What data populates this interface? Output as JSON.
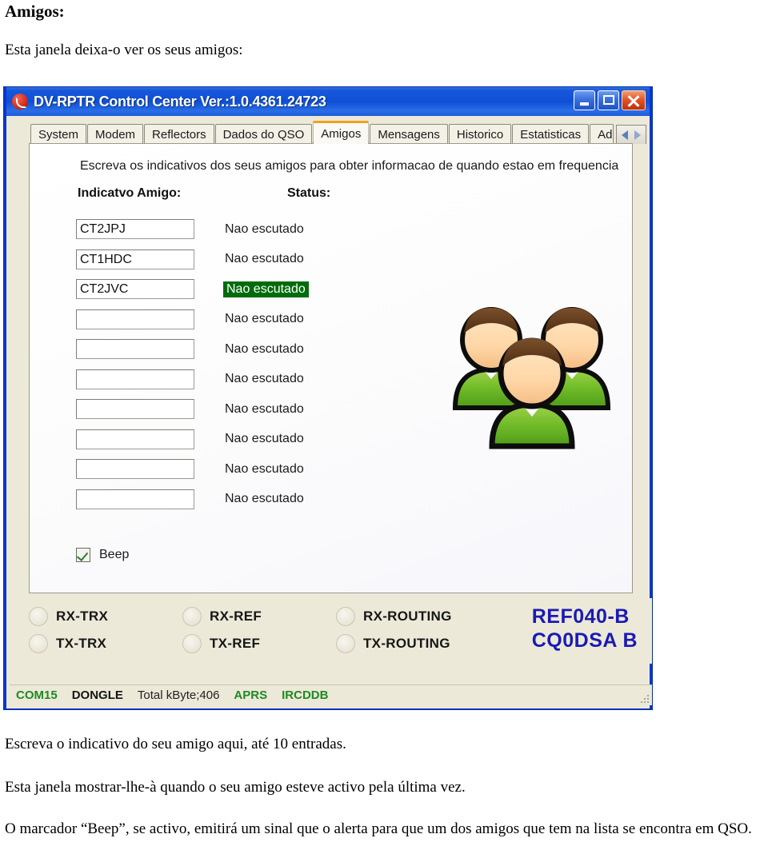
{
  "document": {
    "heading": "Amigos:",
    "intro": "Esta janela deixa-o ver os seus amigos:",
    "para1": "Escreva o indicativo do seu amigo aqui, até 10 entradas.",
    "para2": "Esta janela mostrar-lhe-à quando o seu amigo esteve activo pela última vez.",
    "para3": "O marcador “Beep”, se activo, emitirá um sinal que o alerta para que um dos amigos que tem na lista se encontra em QSO."
  },
  "window": {
    "title": "DV-RPTR Control Center Ver.:1.0.4361.24723",
    "icon": "antenna-icon",
    "controls": {
      "minimize": "minimize-icon",
      "maximize": "maximize-icon",
      "close": "close-icon"
    }
  },
  "tabs": [
    {
      "label": "System",
      "active": false
    },
    {
      "label": "Modem",
      "active": false
    },
    {
      "label": "Reflectors",
      "active": false
    },
    {
      "label": "Dados do QSO",
      "active": false
    },
    {
      "label": "Amigos",
      "active": true
    },
    {
      "label": "Mensagens",
      "active": false
    },
    {
      "label": "Historico",
      "active": false
    },
    {
      "label": "Estatisticas",
      "active": false
    },
    {
      "label": "Adr",
      "active": false
    }
  ],
  "tab_scroll": {
    "left": "◄",
    "right": "►"
  },
  "page": {
    "hint": "Escreva os indicativos dos seus amigos para obter informacao de quando estao em frequencia",
    "col_callsign": "Indicatvo Amigo:",
    "col_status": "Status:",
    "placeholder": "",
    "rows": [
      {
        "callsign": "CT2JPJ",
        "status": "Nao escutado",
        "highlight": false
      },
      {
        "callsign": "CT1HDC",
        "status": "Nao escutado",
        "highlight": false
      },
      {
        "callsign": "CT2JVC",
        "status": "Nao escutado",
        "highlight": true
      },
      {
        "callsign": "",
        "status": "Nao escutado",
        "highlight": false
      },
      {
        "callsign": "",
        "status": "Nao escutado",
        "highlight": false
      },
      {
        "callsign": "",
        "status": "Nao escutado",
        "highlight": false
      },
      {
        "callsign": "",
        "status": "Nao escutado",
        "highlight": false
      },
      {
        "callsign": "",
        "status": "Nao escutado",
        "highlight": false
      },
      {
        "callsign": "",
        "status": "Nao escutado",
        "highlight": false
      },
      {
        "callsign": "",
        "status": "Nao escutado",
        "highlight": false
      }
    ],
    "beep": {
      "label": "Beep",
      "checked": true
    }
  },
  "footer": {
    "leds": [
      {
        "label": "RX-TRX",
        "on": false
      },
      {
        "label": "RX-REF",
        "on": false
      },
      {
        "label": "RX-ROUTING",
        "on": false
      },
      {
        "label": "TX-TRX",
        "on": false
      },
      {
        "label": "TX-REF",
        "on": false
      },
      {
        "label": "TX-ROUTING",
        "on": false
      }
    ],
    "reflector_line1": "REF040-B",
    "reflector_line2": "CQ0DSA B",
    "reflector_color": "#1a1ab4"
  },
  "statusbar": {
    "com_port": "COM15",
    "dongle": "DONGLE",
    "total": "Total kByte;406",
    "aprs": "APRS",
    "ircddb": "IRCDDB",
    "green": "#1f8a22"
  }
}
